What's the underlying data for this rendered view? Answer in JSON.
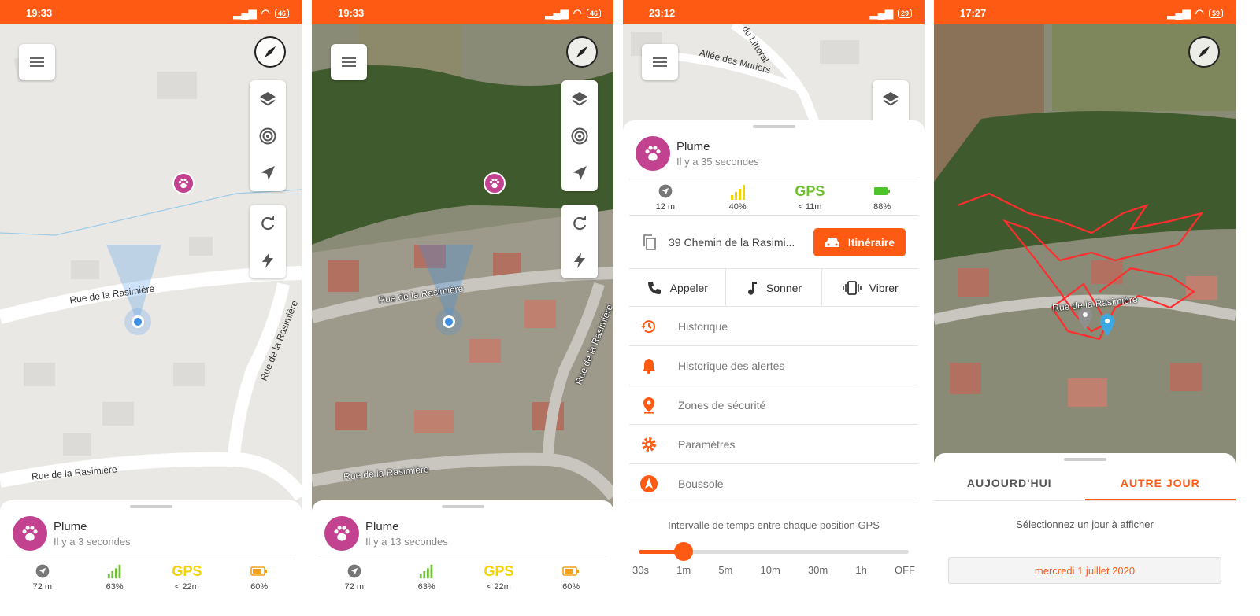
{
  "colors": {
    "accent": "#ff5a13",
    "paw": "#c2428f",
    "signal": "#6cc22e",
    "gps_yellow": "#f2d500",
    "gps_green": "#6cc22e",
    "battery_orange": "#f4a11b",
    "battery_green": "#4fc32a",
    "location": "#3a8ee6",
    "track": "#ff2d2d"
  },
  "screens": [
    {
      "status": {
        "time": "19:33",
        "battery": "46"
      },
      "streets": [
        "Rue de la Rasimière",
        "Rue de la Rasimière",
        "Rue de la Rasimière"
      ],
      "pet": {
        "name": "Plume",
        "ago": "Il y a 3 secondes"
      },
      "stats": {
        "distance": "72 m",
        "signal": "63%",
        "gps_label": "GPS",
        "gps_value": "< 22m",
        "battery": "60%"
      }
    },
    {
      "status": {
        "time": "19:33",
        "battery": "46"
      },
      "streets": [
        "Rue de la Rasimière",
        "Rue de la Rasimière",
        "Rue de la Rasimière"
      ],
      "pet": {
        "name": "Plume",
        "ago": "Il y a 13 secondes"
      },
      "stats": {
        "distance": "72 m",
        "signal": "63%",
        "gps_label": "GPS",
        "gps_value": "< 22m",
        "battery": "60%"
      }
    },
    {
      "status": {
        "time": "23:12",
        "battery": "29"
      },
      "streets": [
        "Allée des Muriers",
        "du Littoral"
      ],
      "pet": {
        "name": "Plume",
        "ago": "Il y a 35 secondes"
      },
      "stats": {
        "distance": "12 m",
        "signal": "40%",
        "gps_label": "GPS",
        "gps_value": "< 11m",
        "battery": "88%"
      },
      "address": "39 Chemin de la Rasimi...",
      "itinerary_label": "Itinéraire",
      "actions": [
        "Appeler",
        "Sonner",
        "Vibrer"
      ],
      "menu": [
        "Historique",
        "Historique des alertes",
        "Zones de sécurité",
        "Paramètres",
        "Boussole"
      ],
      "interval": {
        "label": "Intervalle de temps entre chaque position GPS",
        "ticks": [
          "30s",
          "1m",
          "5m",
          "10m",
          "30m",
          "1h",
          "OFF"
        ],
        "selected_index": 1
      }
    },
    {
      "status": {
        "time": "17:27",
        "battery": "59"
      },
      "streets": [
        "Rue de la Rasimière"
      ],
      "tabs": [
        "AUJOURD'HUI",
        "AUTRE JOUR"
      ],
      "active_tab": 1,
      "select_prompt": "Sélectionnez un jour à afficher",
      "selected_date": "mercredi 1 juillet 2020"
    }
  ]
}
